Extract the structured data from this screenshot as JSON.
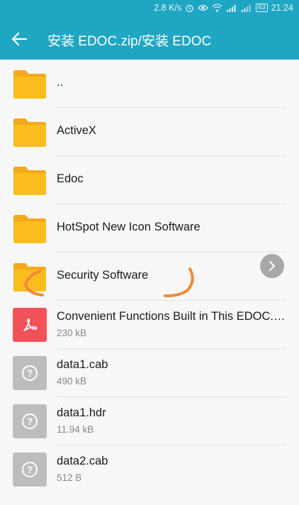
{
  "status_bar": {
    "speed": "2.8 K/s",
    "battery": "63",
    "time": "21:24"
  },
  "app_bar": {
    "title": "安装 EDOC.zip/安装 EDOC"
  },
  "colors": {
    "accent": "#1fa6c3",
    "folder": "#fbbd1d",
    "pdf": "#f1525a",
    "unknown_file": "#bdbdbd",
    "annotation": "#ef8a3c"
  },
  "items": [
    {
      "name": "..",
      "size": "",
      "icon": "folder-icon"
    },
    {
      "name": "ActiveX",
      "size": "",
      "icon": "folder-icon"
    },
    {
      "name": "Edoc",
      "size": "",
      "icon": "folder-icon"
    },
    {
      "name": "HotSpot New Icon Software",
      "size": "",
      "icon": "folder-icon"
    },
    {
      "name": "Security Software",
      "size": "",
      "icon": "folder-icon"
    },
    {
      "name": " Convenient Functions Built in This EDOC.pdf",
      "size": "230 kB",
      "icon": "pdf-icon"
    },
    {
      "name": "data1.cab",
      "size": "490 kB",
      "icon": "unknown-file-icon"
    },
    {
      "name": "data1.hdr",
      "size": "11.94 kB",
      "icon": "unknown-file-icon"
    },
    {
      "name": "data2.cab",
      "size": "512 B",
      "icon": "unknown-file-icon"
    }
  ]
}
